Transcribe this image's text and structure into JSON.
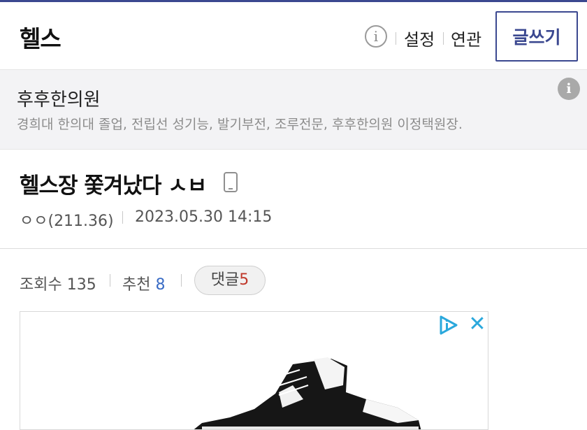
{
  "header": {
    "gallery_title": "헬스",
    "links": [
      "설정",
      "연관"
    ],
    "write_button": "글쓰기",
    "info_icon": "info-icon"
  },
  "ad_banner": {
    "title": "후후한의원",
    "description": "경희대 한의대 졸업, 전립선 성기능, 발기부전, 조루전문, 후후한의원 이정택원장.",
    "info_icon": "info-icon"
  },
  "post": {
    "title": "헬스장 쫓겨났다",
    "title_suffix": "ㅅㅂ",
    "device_icon": "mobile-phone-icon",
    "author": "ㅇㅇ(211.36)",
    "datetime": "2023.05.30 14:15"
  },
  "stats": {
    "views_label": "조회수",
    "views": "135",
    "recommend_label": "추천",
    "recommend": "8",
    "comments_label": "댓글",
    "comments": "5"
  },
  "ad_content": {
    "adchoices_icon": "adchoices-icon",
    "close_icon": "close-icon",
    "image": "sneaker-image"
  },
  "colors": {
    "brand": "#3b4890",
    "recommend_num": "#3a6cc5",
    "comment_num": "#c0392b",
    "ad_icon": "#2aa8dc"
  }
}
